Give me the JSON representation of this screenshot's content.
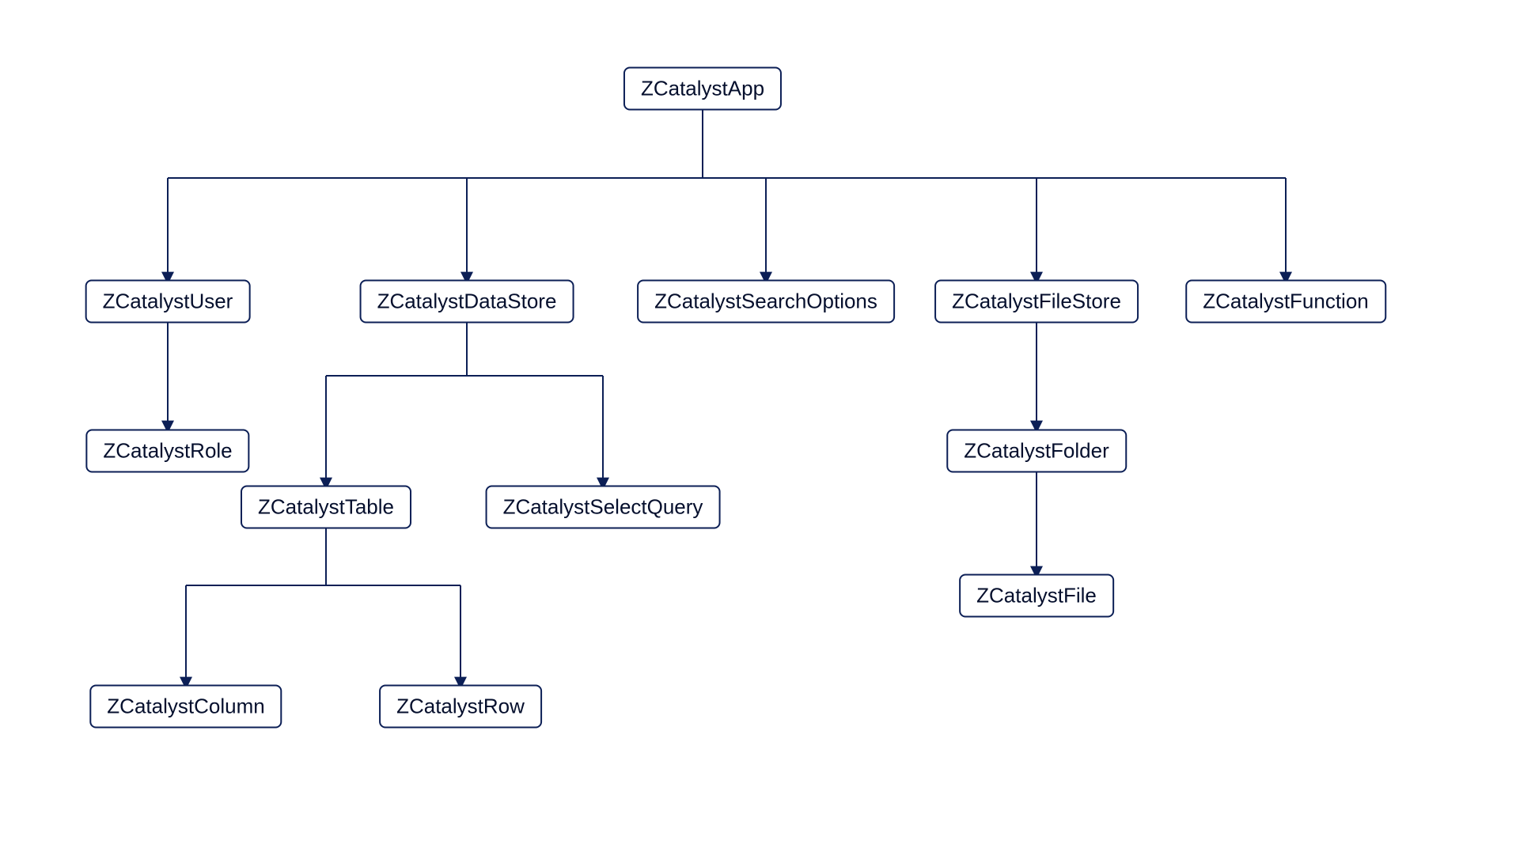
{
  "diagram": {
    "root": "ZCatalystApp",
    "nodes": {
      "user": "ZCatalystUser",
      "datastore": "ZCatalystDataStore",
      "searchoptions": "ZCatalystSearchOptions",
      "filestore": "ZCatalystFileStore",
      "function": "ZCatalystFunction",
      "role": "ZCatalystRole",
      "table": "ZCatalystTable",
      "selectquery": "ZCatalystSelectQuery",
      "column": "ZCatalystColumn",
      "row": "ZCatalystRow",
      "folder": "ZCatalystFolder",
      "file": "ZCatalystFile"
    }
  }
}
